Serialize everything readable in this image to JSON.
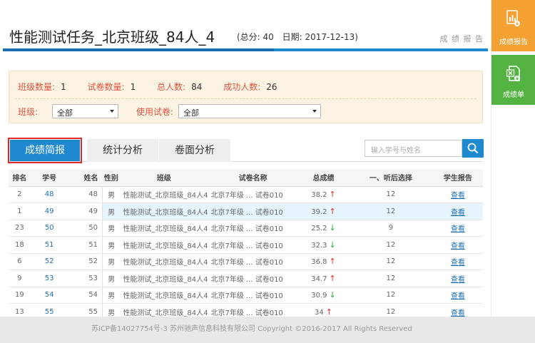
{
  "header": {
    "title": "性能测试任务_北京班级_84人_4",
    "total_score": "(总分: 40",
    "date": "日期: 2017-12-13)",
    "report_link": "成 绩 报 告"
  },
  "filter": {
    "stats": [
      {
        "label": "班级数量:",
        "value": "1"
      },
      {
        "label": "试卷数量:",
        "value": "1"
      },
      {
        "label": "总人数:",
        "value": "84"
      },
      {
        "label": "成功人数:",
        "value": "26"
      }
    ],
    "class_label": "班级:",
    "class_value": "全部",
    "paper_label": "使用试卷:",
    "paper_value": "全部"
  },
  "tabs": [
    "成绩简报",
    "统计分析",
    "卷面分析"
  ],
  "search": {
    "placeholder": "输入学号与姓名"
  },
  "table": {
    "headers": [
      "排名",
      "学号",
      "姓名",
      "性别",
      "班级",
      "试卷名称",
      "总成绩",
      "一、听后选择",
      "学生报告"
    ],
    "view_label": "查看",
    "rows": [
      {
        "rank": "2",
        "id": "48",
        "name": "48",
        "sex": "男",
        "class": "性能测试_北京班级_84人4",
        "paper": "北京7年级 ... 试卷010",
        "score": "38.2",
        "trend": "up",
        "q1": "12"
      },
      {
        "rank": "1",
        "id": "49",
        "name": "49",
        "sex": "男",
        "class": "性能测试_北京班级_84人4",
        "paper": "北京7年级 ... 试卷010",
        "score": "39.2",
        "trend": "up",
        "q1": "12"
      },
      {
        "rank": "23",
        "id": "50",
        "name": "50",
        "sex": "男",
        "class": "性能测试_北京班级_84人4",
        "paper": "北京7年级 ... 试卷010",
        "score": "25.2",
        "trend": "down",
        "q1": "9"
      },
      {
        "rank": "18",
        "id": "51",
        "name": "51",
        "sex": "男",
        "class": "性能测试_北京班级_84人4",
        "paper": "北京7年级 ... 试卷010",
        "score": "32.3",
        "trend": "down",
        "q1": "12"
      },
      {
        "rank": "6",
        "id": "52",
        "name": "52",
        "sex": "男",
        "class": "性能测试_北京班级_84人4",
        "paper": "北京7年级 ... 试卷010",
        "score": "36.8",
        "trend": "up",
        "q1": "12"
      },
      {
        "rank": "9",
        "id": "53",
        "name": "53",
        "sex": "男",
        "class": "性能测试_北京班级_84人4",
        "paper": "北京7年级 ... 试卷010",
        "score": "34.7",
        "trend": "up",
        "q1": "12"
      },
      {
        "rank": "19",
        "id": "54",
        "name": "54",
        "sex": "男",
        "class": "性能测试_北京班级_84人4",
        "paper": "北京7年级 ... 试卷010",
        "score": "30.9",
        "trend": "down",
        "q1": "12"
      },
      {
        "rank": "13",
        "id": "55",
        "name": "55",
        "sex": "男",
        "class": "性能测试_北京班级_84人4",
        "paper": "北京7年级 ... 试卷010",
        "score": "34",
        "trend": "up",
        "q1": "12"
      }
    ]
  },
  "sidebar": {
    "report_label": "成绩报告",
    "sheet_label": "成绩单"
  },
  "footer": {
    "text": "苏ICP备14027754号-3 苏州驰声信息科技有限公司 Copyright ©2016-2017 All Rights Reserved"
  },
  "colors": {
    "accent": "#1f89d0",
    "orange": "#f5a032",
    "green": "#55b344",
    "up": "#e02a2a",
    "down": "#28a745"
  }
}
